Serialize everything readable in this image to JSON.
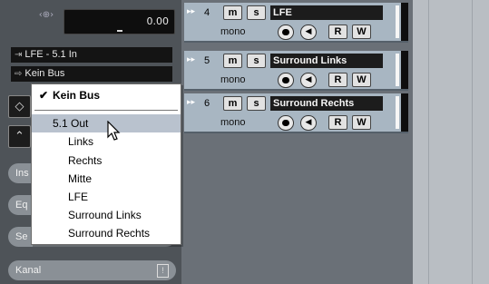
{
  "inspector": {
    "fader_value": "0.00",
    "pan_symbol": "‹⊕›",
    "input_routing": "LFE - 5.1 In",
    "output_routing": "Kein Bus",
    "sections": [
      "Ins",
      "Eq",
      "Se",
      "Kanal"
    ]
  },
  "tracks": [
    {
      "number": "4",
      "name": "LFE",
      "mode": "mono",
      "mute": "m",
      "solo": "s",
      "read": "R",
      "write": "W"
    },
    {
      "number": "5",
      "name": "Surround Links",
      "mode": "mono",
      "mute": "m",
      "solo": "s",
      "read": "R",
      "write": "W"
    },
    {
      "number": "6",
      "name": "Surround Rechts",
      "mode": "mono",
      "mute": "m",
      "solo": "s",
      "read": "R",
      "write": "W"
    }
  ],
  "menu": {
    "checked_item": "Kein Bus",
    "highlighted_item": "5.1 Out",
    "sub_items": [
      "Links",
      "Rechts",
      "Mitte",
      "LFE",
      "Surround Links",
      "Surround Rechts"
    ]
  },
  "colors": {
    "inspector_bg": "#4e5358",
    "track_bg": "#a8b6c2",
    "menu_highlight": "#b9c2ce"
  }
}
